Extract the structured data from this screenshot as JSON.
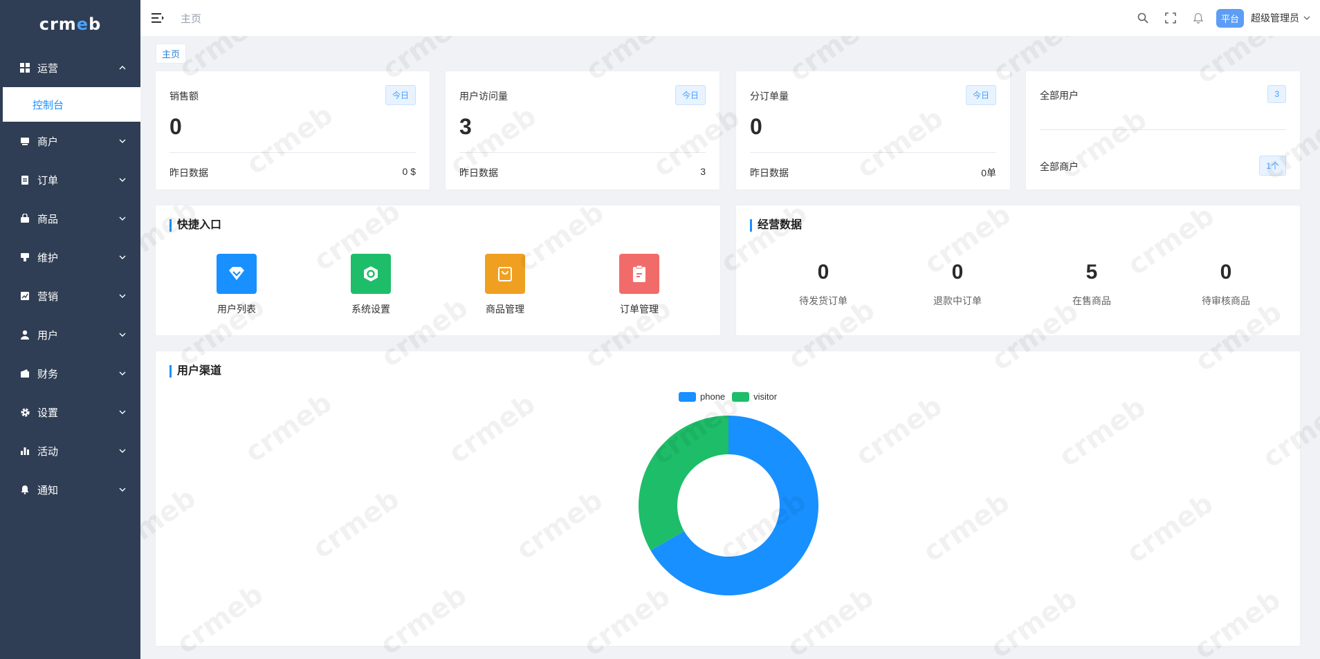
{
  "colors": {
    "sidebar_bg": "#2f3e54",
    "accent": "#1890ff",
    "phone": "#1890ff",
    "visitor": "#1ebd69",
    "quick_user": "#1890ff",
    "quick_settings": "#1ebd69",
    "quick_goods": "#f0a020",
    "quick_orders": "#f26b6b"
  },
  "sidebar": {
    "logo": "crmeb",
    "items": [
      {
        "label": "运营",
        "icon": "grid-icon",
        "expanded": true
      },
      {
        "label": "商户",
        "icon": "store-icon"
      },
      {
        "label": "订单",
        "icon": "clipboard-icon"
      },
      {
        "label": "商品",
        "icon": "bag-icon"
      },
      {
        "label": "维护",
        "icon": "tool-icon"
      },
      {
        "label": "营销",
        "icon": "chart-icon"
      },
      {
        "label": "用户",
        "icon": "user-icon"
      },
      {
        "label": "财务",
        "icon": "wallet-icon"
      },
      {
        "label": "设置",
        "icon": "gear-icon"
      },
      {
        "label": "活动",
        "icon": "bar-chart-icon"
      },
      {
        "label": "通知",
        "icon": "bell-icon"
      }
    ],
    "active_sub": "控制台"
  },
  "header": {
    "breadcrumb": "主页",
    "platform_badge": "平台",
    "user": "超级管理员"
  },
  "tags": {
    "home": "主页"
  },
  "stats": [
    {
      "title": "销售额",
      "badge": "今日",
      "value": "0",
      "foot_label": "昨日数据",
      "foot_value": "0 $"
    },
    {
      "title": "用户访问量",
      "badge": "今日",
      "value": "3",
      "foot_label": "昨日数据",
      "foot_value": "3"
    },
    {
      "title": "分订单量",
      "badge": "今日",
      "value": "0",
      "foot_label": "昨日数据",
      "foot_value": "0单"
    }
  ],
  "users_card": {
    "all_users_label": "全部用户",
    "all_users_value": "3",
    "all_merchants_label": "全部商户",
    "all_merchants_value": "1个"
  },
  "quick": {
    "title": "快捷入口",
    "items": [
      {
        "label": "用户列表",
        "icon": "user-list-icon"
      },
      {
        "label": "系统设置",
        "icon": "settings-icon"
      },
      {
        "label": "商品管理",
        "icon": "shopping-bag-icon"
      },
      {
        "label": "订单管理",
        "icon": "order-icon"
      }
    ]
  },
  "business": {
    "title": "经营数据",
    "items": [
      {
        "value": "0",
        "label": "待发货订单"
      },
      {
        "value": "0",
        "label": "退款中订单"
      },
      {
        "value": "5",
        "label": "在售商品"
      },
      {
        "value": "0",
        "label": "待审核商品"
      }
    ]
  },
  "channel": {
    "title": "用户渠道"
  },
  "chart_data": {
    "type": "pie",
    "donut": true,
    "legend_position": "top-center",
    "series": [
      {
        "name": "phone",
        "value": 2
      },
      {
        "name": "visitor",
        "value": 1
      }
    ]
  }
}
